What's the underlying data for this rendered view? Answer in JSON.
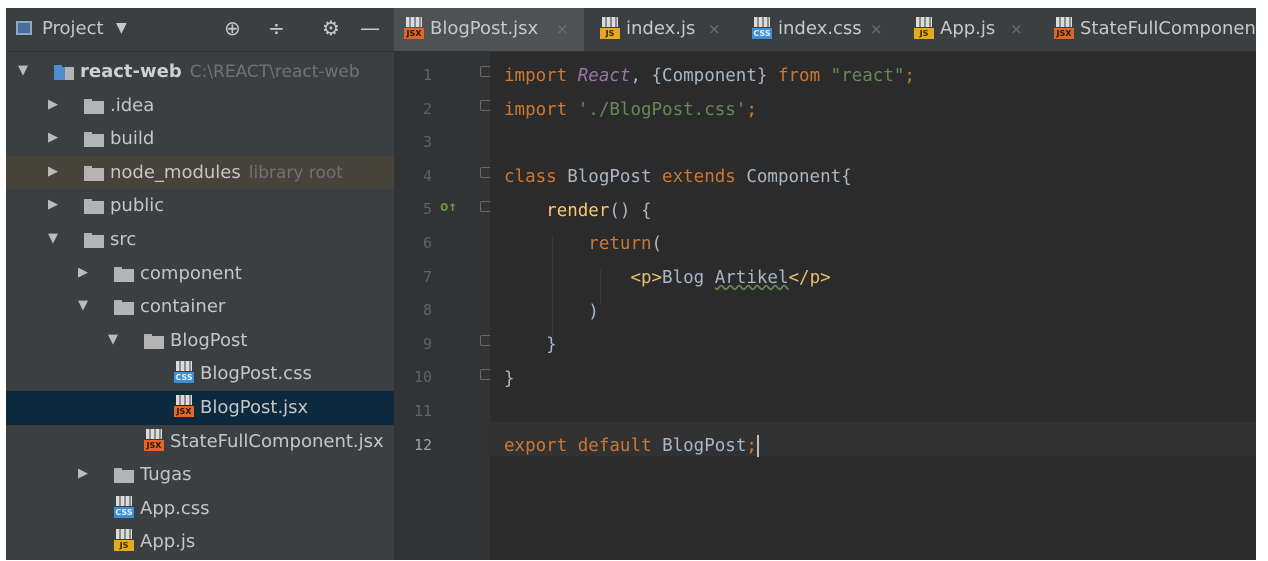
{
  "panel": {
    "title": "Project",
    "caret": "▼",
    "tools": [
      "⊕",
      "÷",
      "⚙",
      "—"
    ]
  },
  "tree": [
    {
      "label": "react-web",
      "hint": "C:\\REACT\\react-web",
      "indent": 0,
      "type": "folder-root",
      "expanded": true
    },
    {
      "label": ".idea",
      "indent": 1,
      "type": "folder",
      "expanded": false
    },
    {
      "label": "build",
      "indent": 1,
      "type": "folder",
      "expanded": false
    },
    {
      "label": "node_modules",
      "hint": "library root",
      "indent": 1,
      "type": "folder",
      "expanded": false,
      "state": "highlight"
    },
    {
      "label": "public",
      "indent": 1,
      "type": "folder",
      "expanded": false
    },
    {
      "label": "src",
      "indent": 1,
      "type": "folder",
      "expanded": true
    },
    {
      "label": "component",
      "indent": 2,
      "type": "folder",
      "expanded": false
    },
    {
      "label": "container",
      "indent": 2,
      "type": "folder",
      "expanded": true
    },
    {
      "label": "BlogPost",
      "indent": 3,
      "type": "folder",
      "expanded": true
    },
    {
      "label": "BlogPost.css",
      "indent": 4,
      "type": "file",
      "ext": "css"
    },
    {
      "label": "BlogPost.jsx",
      "indent": 4,
      "type": "file",
      "ext": "jsx",
      "state": "selected"
    },
    {
      "label": "StateFullComponent.jsx",
      "indent": 3,
      "type": "file",
      "ext": "jsx"
    },
    {
      "label": "Tugas",
      "indent": 2,
      "type": "folder",
      "expanded": false
    },
    {
      "label": "App.css",
      "indent": 2,
      "type": "file",
      "ext": "css"
    },
    {
      "label": "App.js",
      "indent": 2,
      "type": "file",
      "ext": "js"
    }
  ],
  "tabs": [
    {
      "label": "BlogPost.jsx",
      "ext": "jsx",
      "active": true
    },
    {
      "label": "index.js",
      "ext": "js"
    },
    {
      "label": "index.css",
      "ext": "css"
    },
    {
      "label": "App.js",
      "ext": "js"
    },
    {
      "label": "StateFullComponen",
      "ext": "jsx"
    }
  ],
  "file_tag_text": {
    "css": "CSS",
    "jsx": "JSX",
    "js": "JS"
  },
  "close_glyph": "×",
  "gutter": {
    "line_numbers": [
      "1",
      "2",
      "3",
      "4",
      "5",
      "6",
      "7",
      "8",
      "9",
      "10",
      "11",
      "12"
    ],
    "current_line": "12",
    "override_marker": "o↑"
  },
  "code": {
    "l1": {
      "a": "import ",
      "b": "React",
      "c": ", {Component} ",
      "d": "from ",
      "e": "\"react\"",
      "f": ";"
    },
    "l2": {
      "a": "import ",
      "b": "'./BlogPost.css'",
      "c": ";"
    },
    "l4": {
      "a": "class ",
      "b": "BlogPost ",
      "c": "extends ",
      "d": "Component{"
    },
    "l5": {
      "a": "    ",
      "b": "render",
      "c": "() {"
    },
    "l6": {
      "a": "        ",
      "b": "return",
      "c": "("
    },
    "l7": {
      "a": "            ",
      "b": "<p>",
      "c": "Blog ",
      "d": "Artikel",
      "e": "</p>"
    },
    "l8": {
      "a": "        )"
    },
    "l9": {
      "a": "    }"
    },
    "l10": {
      "a": "}"
    },
    "l12": {
      "a": "export ",
      "b": "default ",
      "c": "BlogPost",
      "d": ";"
    }
  }
}
